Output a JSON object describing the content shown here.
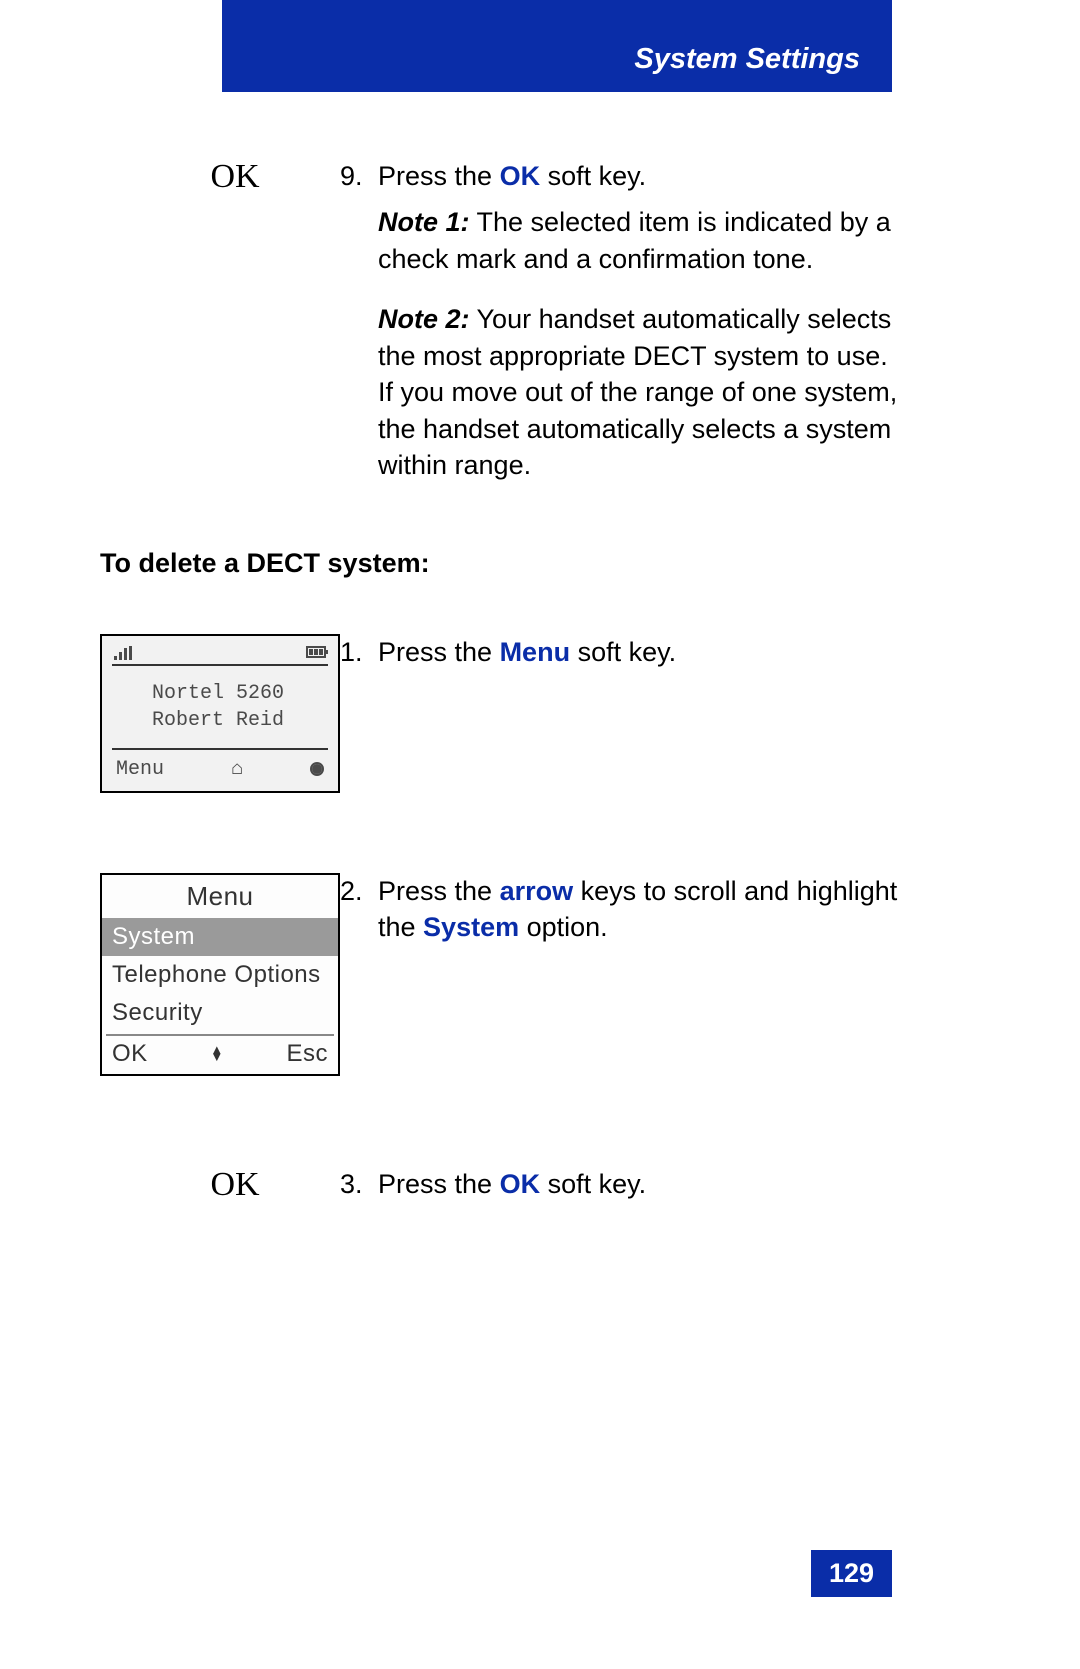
{
  "header": {
    "title": "System Settings"
  },
  "step9": {
    "left_label": "OK",
    "num": "9.",
    "text_before": "Press the ",
    "key": "OK",
    "text_after": " soft key."
  },
  "note1": {
    "label": "Note 1:",
    "text": " The selected item is indicated by a check mark and a confirmation tone."
  },
  "note2": {
    "label": "Note 2:",
    "text": " Your handset automatically selects the most appropriate DECT system to use. If you move out of the range of one system, the handset automatically selects a system within range."
  },
  "section_heading": "To delete a DECT system:",
  "screen1": {
    "line1": "Nortel 5260",
    "line2": "Robert Reid",
    "softkey_left": "Menu"
  },
  "step1": {
    "num": "1.",
    "text_before": "Press the ",
    "key": "Menu",
    "text_after": " soft key."
  },
  "screen2": {
    "title": "Menu",
    "item1": "System",
    "item2": "Telephone Options",
    "item3": "Security",
    "softkey_left": "OK",
    "softkey_right": "Esc"
  },
  "step2": {
    "num": "2.",
    "text_before": "Press the ",
    "key1": "arrow",
    "text_mid": " keys to scroll and highlight the ",
    "key2": "System",
    "text_after": " option."
  },
  "step3": {
    "left_label": "OK",
    "num": "3.",
    "text_before": "Press the ",
    "key": "OK",
    "text_after": " soft key."
  },
  "page_number": "129"
}
